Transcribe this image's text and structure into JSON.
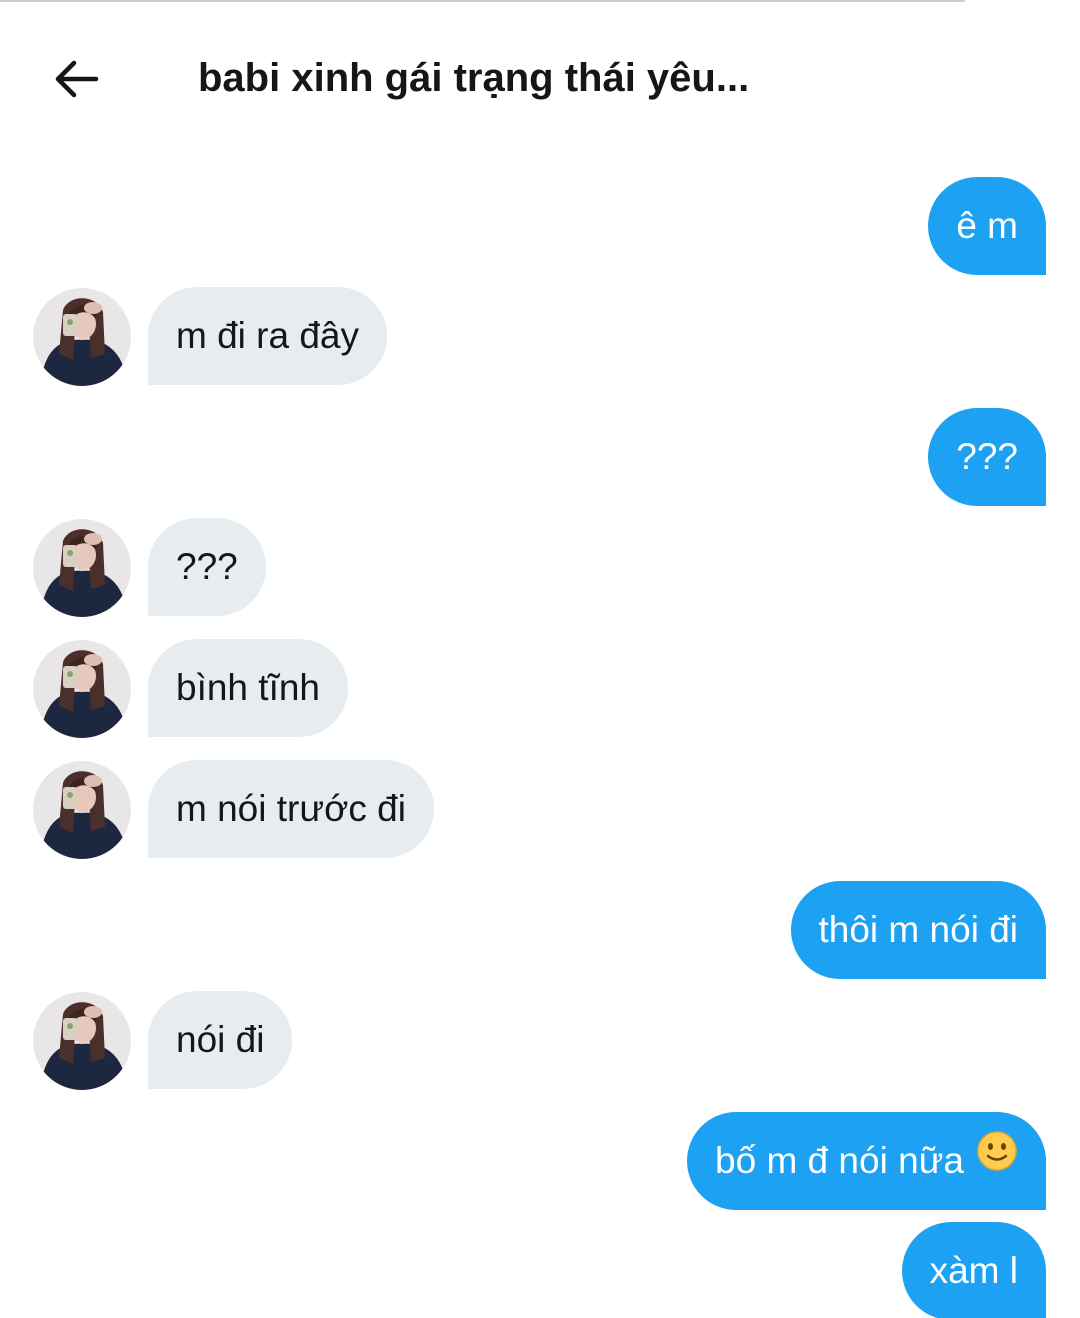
{
  "header": {
    "back_icon": "arrow-left-icon",
    "title": "babi xinh gái trạng thái yêu..."
  },
  "colors": {
    "sent_bubble": "#1da1f2",
    "received_bubble": "#e6ecf0",
    "text_dark": "#14171a"
  },
  "messages": [
    {
      "side": "sent",
      "text": "ê m"
    },
    {
      "side": "received",
      "text": "m đi ra đây"
    },
    {
      "side": "sent",
      "text": "???"
    },
    {
      "side": "received",
      "text": "???"
    },
    {
      "side": "received",
      "text": "bình tĩnh"
    },
    {
      "side": "received",
      "text": "m nói trước đi"
    },
    {
      "side": "sent",
      "text": "thôi m nói đi"
    },
    {
      "side": "received",
      "text": "nói đi"
    },
    {
      "side": "sent",
      "text": "bố m đ nói nữa",
      "emoji": "slightly-smiling-face-icon"
    },
    {
      "side": "sent",
      "text": "xàm l"
    }
  ]
}
